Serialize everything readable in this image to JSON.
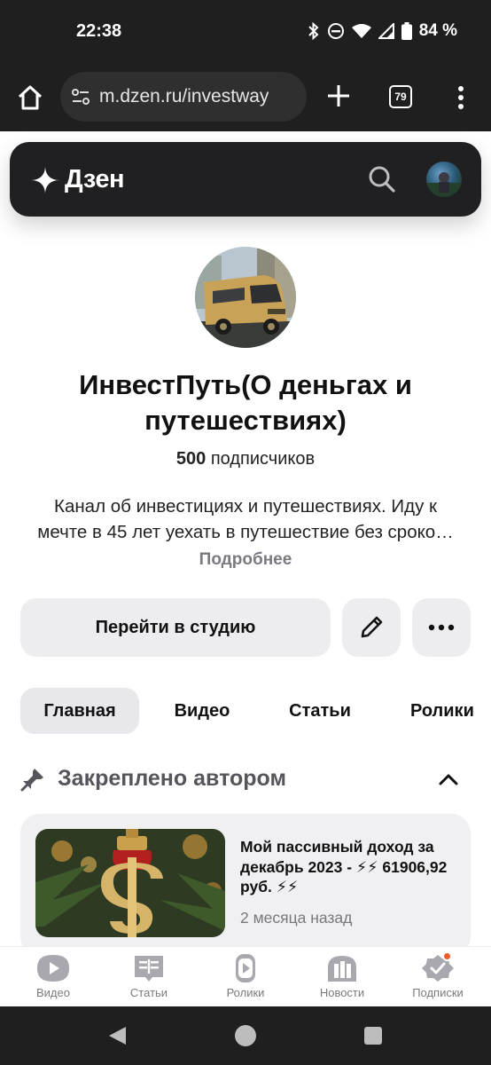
{
  "status_bar": {
    "time": "22:38",
    "battery": "84 %",
    "icons": [
      "bluetooth-icon",
      "dnd-icon",
      "wifi-icon",
      "signal-icon",
      "battery-icon"
    ]
  },
  "browser": {
    "url": "m.dzen.ru/investway",
    "tab_count": "79"
  },
  "header": {
    "logo_text": "Дзен"
  },
  "channel": {
    "name": "ИнвестПуть(О деньгах и путешествиях)",
    "subscribers_count": "500",
    "subscribers_label": "подписчиков",
    "description_line1": "Канал об инвестициях и путешествиях. Иду к",
    "description_line2": "мечте в 45 лет уехать в путешествие без сроко…",
    "more_label": "Подробнее"
  },
  "actions": {
    "studio_label": "Перейти в студию"
  },
  "tabs": [
    {
      "label": "Главная",
      "active": true
    },
    {
      "label": "Видео",
      "active": false
    },
    {
      "label": "Статьи",
      "active": false
    },
    {
      "label": "Ролики",
      "active": false
    }
  ],
  "pinned": {
    "title": "Закреплено автором",
    "card": {
      "title": "Мой пассивный доход за декабрь 2023 - ⚡⚡ 61906,92 руб. ⚡⚡",
      "date": "2 месяца назад"
    }
  },
  "bottom_nav": [
    {
      "label": "Видео",
      "icon": "video-icon"
    },
    {
      "label": "Статьи",
      "icon": "articles-icon"
    },
    {
      "label": "Ролики",
      "icon": "shorts-icon"
    },
    {
      "label": "Новости",
      "icon": "news-icon"
    },
    {
      "label": "Подписки",
      "icon": "subscriptions-icon"
    }
  ],
  "colors": {
    "accent_notification": "#f25a2a",
    "header_bg": "#202022",
    "button_bg": "#ededf0"
  }
}
